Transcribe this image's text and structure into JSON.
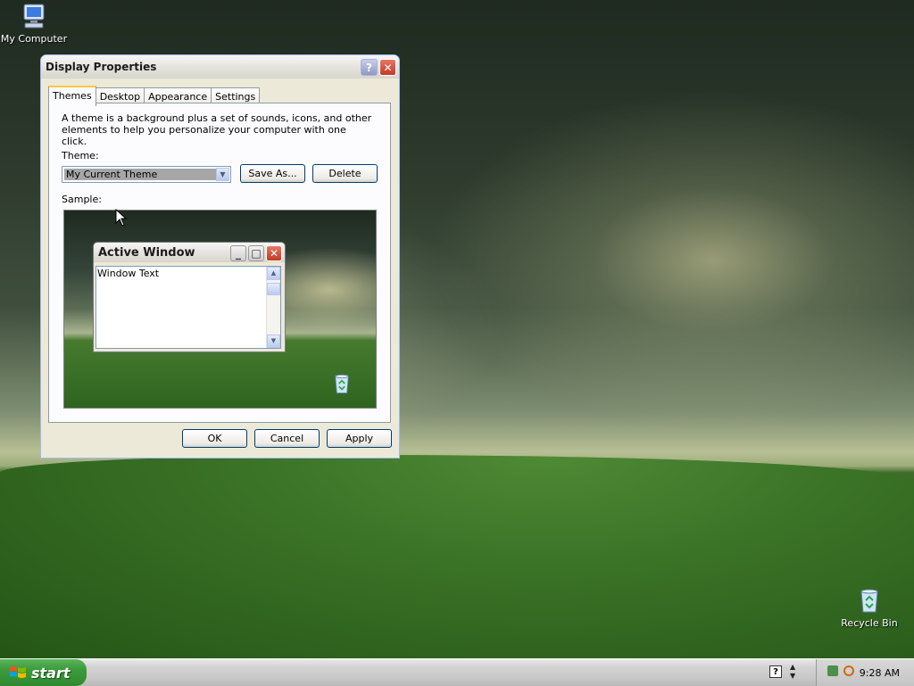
{
  "desktop": {
    "icons": [
      {
        "label": "My Computer"
      },
      {
        "label": "Recycle Bin"
      }
    ]
  },
  "dialog": {
    "title": "Display Properties",
    "tabs": [
      {
        "label": "Themes",
        "active": true
      },
      {
        "label": "Desktop"
      },
      {
        "label": "Appearance"
      },
      {
        "label": "Settings"
      }
    ],
    "description": "A theme is a background plus a set of sounds, icons, and other elements to help you personalize your computer with one click.",
    "theme_label": "Theme:",
    "theme_value": "My Current Theme",
    "save_as_label": "Save As...",
    "delete_label": "Delete",
    "sample_label": "Sample:",
    "sample": {
      "window_title": "Active Window",
      "window_text": "Window Text"
    },
    "ok_label": "OK",
    "cancel_label": "Cancel",
    "apply_label": "Apply"
  },
  "taskbar": {
    "start_label": "start",
    "clock": "9:28 AM"
  }
}
